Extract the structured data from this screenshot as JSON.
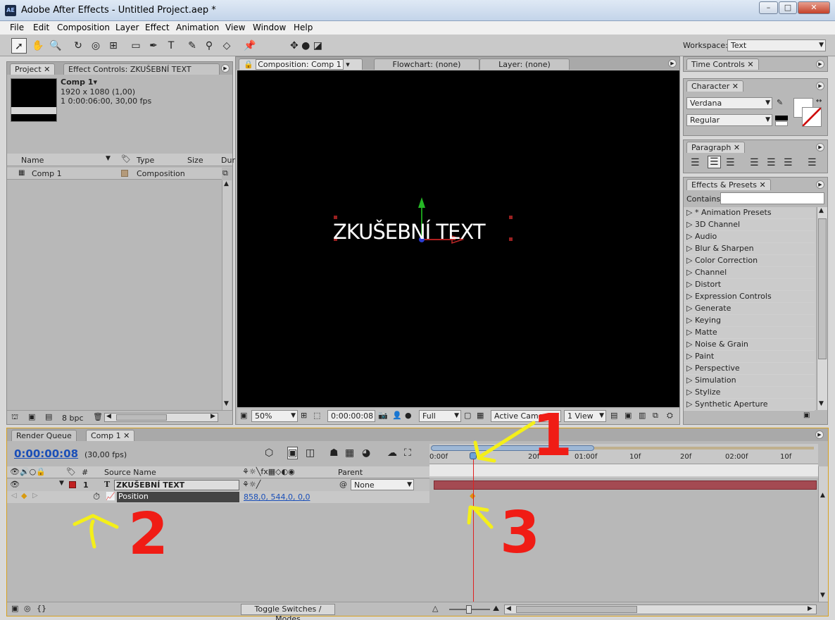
{
  "window": {
    "title": "Adobe After Effects - Untitled Project.aep *",
    "app_icon": "AE"
  },
  "menu": [
    "File",
    "Edit",
    "Composition",
    "Layer",
    "Effect",
    "Animation",
    "View",
    "Window",
    "Help"
  ],
  "workspace": {
    "label": "Workspace:",
    "value": "Text"
  },
  "project": {
    "tab": "Project",
    "effect_tab": "Effect Controls: ZKUŠEBNÍ TEXT",
    "comp_name": "Comp 1▾",
    "comp_size": "1920 x 1080 (1,00)",
    "comp_dur": "1 0:00:06:00, 30,00 fps",
    "col_name": "Name",
    "col_type": "Type",
    "col_size": "Size",
    "col_dur": "Dur",
    "item_name": "Comp 1",
    "item_type": "Composition",
    "bpc": "8 bpc"
  },
  "viewer": {
    "tab_comp": "Composition: Comp 1",
    "tab_flow": "Flowchart: (none)",
    "tab_layer": "Layer: (none)",
    "text": "ZKUŠEBNÍ TEXT",
    "zoom": "50%",
    "timecode": "0:00:00:08",
    "resolution": "Full",
    "camera": "Active Camera",
    "views": "1 View"
  },
  "time_controls": {
    "tab": "Time Controls"
  },
  "character": {
    "tab": "Character",
    "font": "Verdana",
    "style": "Regular"
  },
  "paragraph": {
    "tab": "Paragraph"
  },
  "effects": {
    "tab": "Effects & Presets",
    "contains": "Contains:",
    "items": [
      "* Animation Presets",
      "3D Channel",
      "Audio",
      "Blur & Sharpen",
      "Color Correction",
      "Channel",
      "Distort",
      "Expression Controls",
      "Generate",
      "Keying",
      "Matte",
      "Noise & Grain",
      "Paint",
      "Perspective",
      "Simulation",
      "Stylize",
      "Synthetic Aperture"
    ]
  },
  "timeline": {
    "tab_render": "Render Queue",
    "tab_comp": "Comp 1",
    "timecode": "0:00:00:08",
    "fps": "(30,00 fps)",
    "col_num": "#",
    "col_source": "Source Name",
    "col_parent": "Parent",
    "layer_num": "1",
    "layer_name": "ZKUŠEBNÍ TEXT",
    "parent_value": "None",
    "prop_name": "Position",
    "prop_value": "858,0, 544,0, 0,0",
    "ruler": [
      "0:00f",
      "20f",
      "01:00f",
      "10f",
      "20f",
      "02:00f",
      "10f"
    ],
    "toggle": "Toggle Switches / Modes"
  },
  "annotations": [
    "1",
    "2",
    "3"
  ]
}
